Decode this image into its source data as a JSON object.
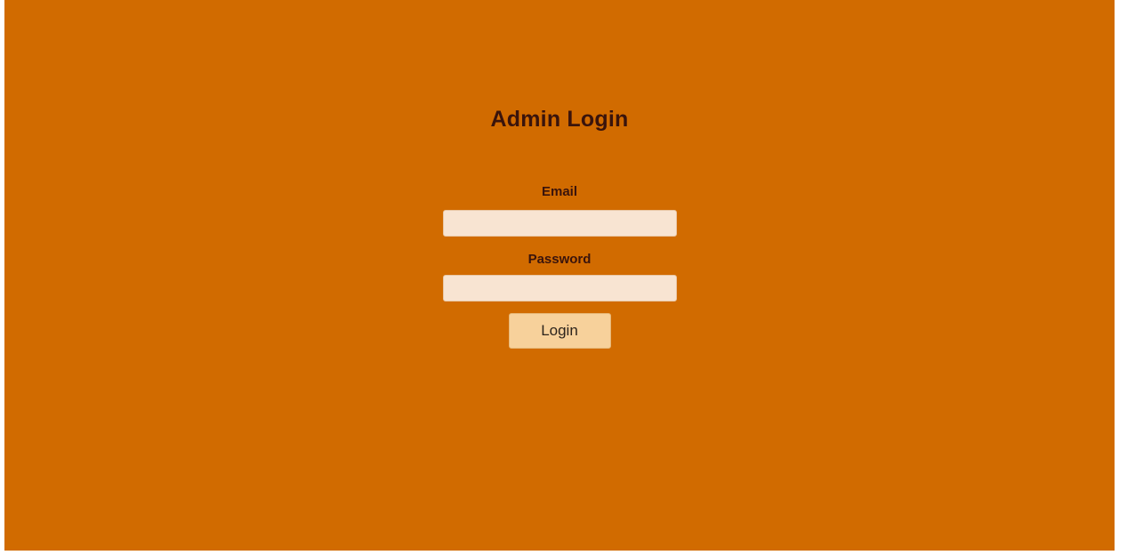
{
  "login": {
    "title": "Admin Login",
    "email_label": "Email",
    "email_value": "",
    "password_label": "Password",
    "password_value": "",
    "button_label": "Login"
  },
  "colors": {
    "background": "#d16b00",
    "text": "#3a140c",
    "input_fill": "#f8e4d2",
    "button_fill": "#f7d19b"
  }
}
